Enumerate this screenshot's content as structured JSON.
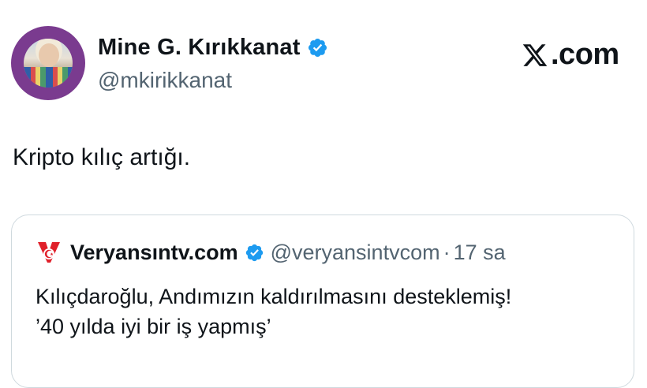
{
  "author": {
    "display_name": "Mine G. Kırıkkanat",
    "handle": "@mkirikkanat",
    "verified": true,
    "avatar_icon": "profile-photo-avatar"
  },
  "brand": {
    "label": ".com",
    "icon": "x-logo-icon"
  },
  "tweet": {
    "text": "Kripto kılıç artığı."
  },
  "quote": {
    "display_name": "Veryansıntv.com",
    "handle": "@veryansintvcom",
    "separator": "·",
    "time": "17 sa",
    "verified": true,
    "logo_icon": "veryansin-logo-icon",
    "text_line1": "Kılıçdaroğlu, Andımızın kaldırılmasını desteklemiş!",
    "text_line2": "’40 yılda iyi bir iş yapmış’"
  },
  "colors": {
    "verified_blue": "#1d9bf0",
    "text_primary": "#0f1419",
    "text_secondary": "#536471",
    "border": "#cfd9de",
    "avatar_ring": "#7a3b8f",
    "logo_red": "#e0202a"
  }
}
